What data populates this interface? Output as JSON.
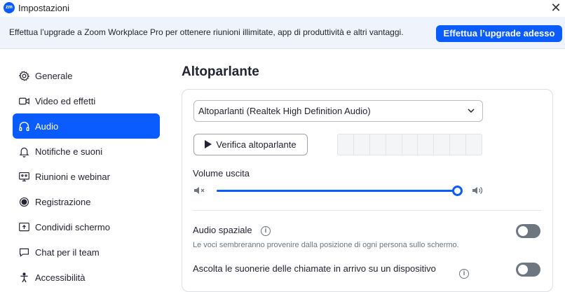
{
  "window": {
    "title": "Impostazioni",
    "logo_text": "zm"
  },
  "banner": {
    "text": "Effettua l’upgrade a Zoom Workplace Pro per ottenere riunioni illimitate, app di produttività e altri vantaggi.",
    "button_label": "Effettua l’upgrade adesso"
  },
  "sidebar": {
    "items": [
      {
        "label": "Generale",
        "icon": "gear-icon"
      },
      {
        "label": "Video ed effetti",
        "icon": "video-camera-icon"
      },
      {
        "label": "Audio",
        "icon": "headphones-icon",
        "active": true
      },
      {
        "label": "Notifiche e suoni",
        "icon": "bell-icon"
      },
      {
        "label": "Riunioni e webinar",
        "icon": "meeting-screen-icon"
      },
      {
        "label": "Registrazione",
        "icon": "record-icon"
      },
      {
        "label": "Condividi schermo",
        "icon": "share-screen-icon"
      },
      {
        "label": "Chat per il team",
        "icon": "chat-bubble-icon"
      },
      {
        "label": "Accessibilità",
        "icon": "accessibility-icon"
      }
    ]
  },
  "main": {
    "section_title": "Altoparlante",
    "speaker_select": {
      "value": "Altoparlanti (Realtek High Definition Audio)"
    },
    "test_button_label": "Verifica altoparlante",
    "volume": {
      "label": "Volume uscita",
      "level": 1.0
    },
    "options": [
      {
        "title": "Audio spaziale",
        "description": "Le voci sembreranno provenire dalla posizione di ogni persona sullo schermo.",
        "enabled": false
      },
      {
        "title": "Ascolta le suonerie delle chiamate in arrivo su un dispositivo",
        "enabled": false
      }
    ]
  },
  "colors": {
    "accent": "#0b5cff",
    "banner_bg": "#eef3fc",
    "toggle_off": "#6e7680"
  }
}
